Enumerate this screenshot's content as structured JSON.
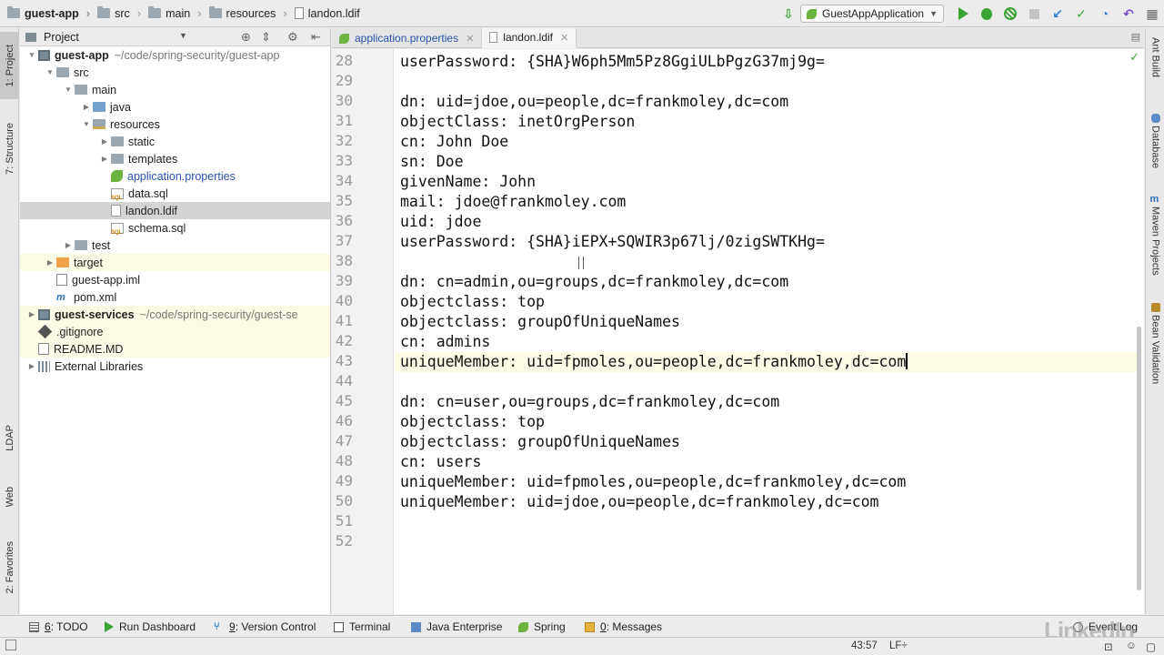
{
  "breadcrumbs": [
    "guest-app",
    "src",
    "main",
    "resources",
    "landon.ldif"
  ],
  "run_config": "GuestAppApplication",
  "left_tool_tabs": [
    "1: Project",
    "7: Structure",
    "LDAP",
    "Web",
    "2: Favorites"
  ],
  "right_tool_tabs": [
    "Ant Build",
    "Database",
    "Maven Projects",
    "Bean Validation"
  ],
  "project_panel": {
    "title": "Project",
    "tree": [
      {
        "label": "guest-app",
        "path": "~/code/spring-security/guest-app",
        "depth": 0,
        "arrow": "open",
        "icon": "module",
        "bold": true
      },
      {
        "label": "src",
        "depth": 1,
        "arrow": "open",
        "icon": "folder"
      },
      {
        "label": "main",
        "depth": 2,
        "arrow": "open",
        "icon": "folder"
      },
      {
        "label": "java",
        "depth": 3,
        "arrow": "closed",
        "icon": "folder-blue"
      },
      {
        "label": "resources",
        "depth": 3,
        "arrow": "open",
        "icon": "folder-res"
      },
      {
        "label": "static",
        "depth": 4,
        "arrow": "closed",
        "icon": "folder"
      },
      {
        "label": "templates",
        "depth": 4,
        "arrow": "closed",
        "icon": "folder"
      },
      {
        "label": "application.properties",
        "depth": 4,
        "arrow": "none",
        "icon": "props",
        "blue": true
      },
      {
        "label": "data.sql",
        "depth": 4,
        "arrow": "none",
        "icon": "sql"
      },
      {
        "label": "landon.ldif",
        "depth": 4,
        "arrow": "none",
        "icon": "file",
        "selected": true
      },
      {
        "label": "schema.sql",
        "depth": 4,
        "arrow": "none",
        "icon": "sql"
      },
      {
        "label": "test",
        "depth": 2,
        "arrow": "closed",
        "icon": "folder"
      },
      {
        "label": "target",
        "depth": 1,
        "arrow": "closed",
        "icon": "folder-orange",
        "ignored": true
      },
      {
        "label": "guest-app.iml",
        "depth": 1,
        "arrow": "none",
        "icon": "iml"
      },
      {
        "label": "pom.xml",
        "depth": 1,
        "arrow": "none",
        "icon": "maven"
      },
      {
        "label": "guest-services",
        "path": "~/code/spring-security/guest-se",
        "depth": 0,
        "arrow": "closed",
        "icon": "module",
        "bold": true,
        "ignored": true
      },
      {
        "label": ".gitignore",
        "depth": 0,
        "arrow": "none",
        "icon": "git",
        "ignored": true
      },
      {
        "label": "README.MD",
        "depth": 0,
        "arrow": "none",
        "icon": "md",
        "ignored": true
      },
      {
        "label": "External Libraries",
        "depth": 0,
        "arrow": "closed",
        "icon": "lib"
      }
    ]
  },
  "tabs": [
    {
      "label": "application.properties",
      "icon": "props",
      "active": false,
      "blue": true
    },
    {
      "label": "landon.ldif",
      "icon": "file",
      "active": true,
      "blue": false
    }
  ],
  "editor": {
    "first_line": 28,
    "current_line": 43,
    "lines": [
      "userPassword: {SHA}W6ph5Mm5Pz8GgiULbPgzG37mj9g=",
      "",
      "dn: uid=jdoe,ou=people,dc=frankmoley,dc=com",
      "objectClass: inetOrgPerson",
      "cn: John Doe",
      "sn: Doe",
      "givenName: John",
      "mail: jdoe@frankmoley.com",
      "uid: jdoe",
      "userPassword: {SHA}iEPX+SQWIR3p67lj/0zigSWTKHg=",
      "",
      "dn: cn=admin,ou=groups,dc=frankmoley,dc=com",
      "objectclass: top",
      "objectclass: groupOfUniqueNames",
      "cn: admins",
      "uniqueMember: uid=fpmoles,ou=people,dc=frankmoley,dc=com",
      "",
      "dn: cn=user,ou=groups,dc=frankmoley,dc=com",
      "objectclass: top",
      "objectclass: groupOfUniqueNames",
      "cn: users",
      "uniqueMember: uid=fpmoles,ou=people,dc=frankmoley,dc=com",
      "uniqueMember: uid=jdoe,ou=people,dc=frankmoley,dc=com",
      "",
      ""
    ]
  },
  "bottom_tools": [
    {
      "key": "6",
      "label": ": TODO"
    },
    {
      "key": "",
      "label": "Run Dashboard"
    },
    {
      "key": "9",
      "label": ": Version Control"
    },
    {
      "key": "",
      "label": "Terminal"
    },
    {
      "key": "",
      "label": "Java Enterprise"
    },
    {
      "key": "",
      "label": "Spring"
    },
    {
      "key": "0",
      "label": ": Messages"
    },
    {
      "key": "",
      "label": "Event Log"
    }
  ],
  "watermark": "LinkedIn",
  "status": {
    "position": "43:57",
    "line_sep": "LF",
    "line_sep_suffix": "÷"
  }
}
